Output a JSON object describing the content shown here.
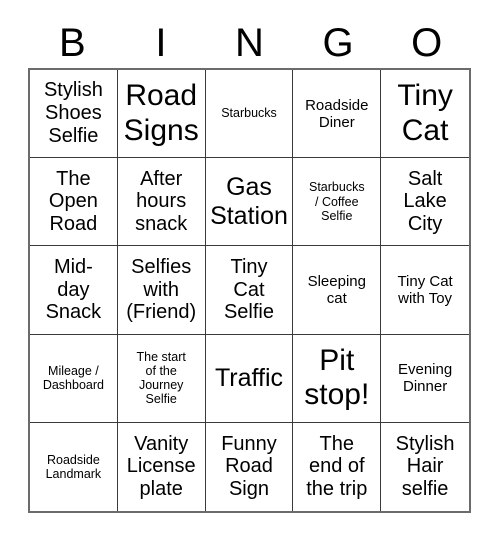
{
  "card": {
    "title": "BINGO",
    "header_letters": [
      "B",
      "I",
      "N",
      "G",
      "O"
    ],
    "rows": 5,
    "columns": 5,
    "colors": {
      "background": "#ffffff",
      "text": "#000000",
      "grid_line": "#3a3a3a",
      "grid_outer": "#6b6b6b"
    },
    "cells": [
      {
        "text": "Stylish\nShoes\nSelfie",
        "size": "md"
      },
      {
        "text": "Road\nSigns",
        "size": "xl"
      },
      {
        "text": "Starbucks",
        "size": "xs"
      },
      {
        "text": "Roadside\nDiner",
        "size": "sm"
      },
      {
        "text": "Tiny\nCat",
        "size": "xl"
      },
      {
        "text": "The\nOpen\nRoad",
        "size": "md"
      },
      {
        "text": "After\nhours\nsnack",
        "size": "md"
      },
      {
        "text": "Gas\nStation",
        "size": "lg"
      },
      {
        "text": "Starbucks\n/ Coffee\nSelfie",
        "size": "xs"
      },
      {
        "text": "Salt\nLake\nCity",
        "size": "md"
      },
      {
        "text": "Mid-\nday\nSnack",
        "size": "md"
      },
      {
        "text": "Selfies\nwith\n(Friend)",
        "size": "md"
      },
      {
        "text": "Tiny\nCat\nSelfie",
        "size": "md"
      },
      {
        "text": "Sleeping\ncat",
        "size": "sm"
      },
      {
        "text": "Tiny Cat\nwith Toy",
        "size": "sm"
      },
      {
        "text": "Mileage /\nDashboard",
        "size": "xs"
      },
      {
        "text": "The start\nof the\nJourney\nSelfie",
        "size": "xs"
      },
      {
        "text": "Traffic",
        "size": "lg"
      },
      {
        "text": "Pit\nstop!",
        "size": "xl"
      },
      {
        "text": "Evening\nDinner",
        "size": "sm"
      },
      {
        "text": "Roadside\nLandmark",
        "size": "xs"
      },
      {
        "text": "Vanity\nLicense\nplate",
        "size": "md"
      },
      {
        "text": "Funny\nRoad\nSign",
        "size": "md"
      },
      {
        "text": "The\nend of\nthe trip",
        "size": "md"
      },
      {
        "text": "Stylish\nHair\nselfie",
        "size": "md"
      }
    ]
  }
}
